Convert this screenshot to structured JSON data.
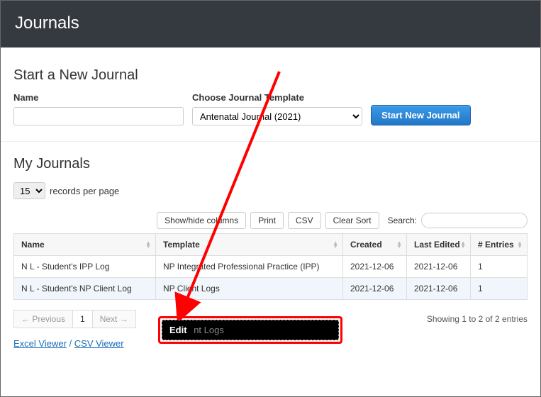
{
  "header": {
    "title": "Journals"
  },
  "newJournal": {
    "section_title": "Start a New Journal",
    "name_label": "Name",
    "template_label": "Choose Journal Template",
    "template_selected": "Antenatal Journal (2021)",
    "start_button": "Start New Journal"
  },
  "myJournals": {
    "section_title": "My Journals",
    "records_select_value": "15",
    "records_suffix": "records per page",
    "toolbar": {
      "show_hide": "Show/hide columns",
      "print": "Print",
      "csv": "CSV",
      "clear_sort": "Clear Sort",
      "search_label": "Search:"
    },
    "columns": [
      "Name",
      "Template",
      "Created",
      "Last Edited",
      "# Entries"
    ],
    "rows": [
      {
        "name": "N L - Student's IPP Log",
        "template": "NP Integrated Professional Practice (IPP)",
        "created": "2021-12-06",
        "last_edited": "2021-12-06",
        "entries": "1"
      },
      {
        "name": "N L - Student's NP Client Log",
        "template": "NP Client Logs",
        "created": "2021-12-06",
        "last_edited": "2021-12-06",
        "entries": "1"
      }
    ],
    "pager": {
      "prev": "← Previous",
      "page": "1",
      "next": "Next →"
    },
    "showing": "Showing 1 to 2 of 2 entries",
    "downloads": {
      "excel": "Excel Viewer",
      "csv": "CSV Viewer"
    }
  },
  "annotation": {
    "edit_label": "Edit",
    "edit_sub": "nt Logs"
  }
}
